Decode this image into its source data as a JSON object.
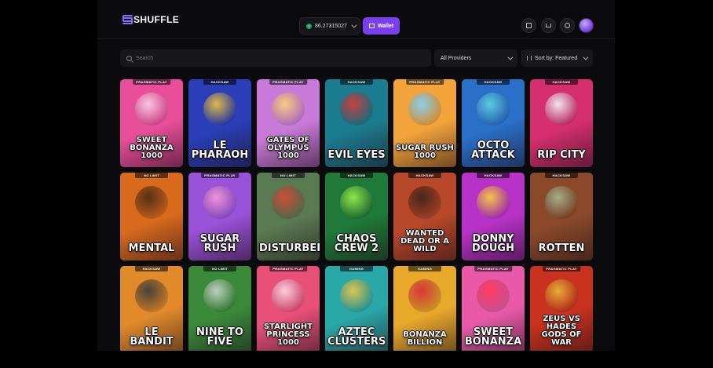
{
  "header": {
    "logo_text": "SHUFFLE",
    "balance": "86.27315027",
    "wallet_label": "Wallet",
    "icons": [
      "rewards-icon",
      "vip-crown-icon",
      "chat-icon"
    ]
  },
  "filters": {
    "search_placeholder": "Search",
    "provider_select": "All Providers",
    "sort_select": "Sort by: Featured"
  },
  "games": [
    {
      "title": "Sweet Bonanza 1000",
      "provider": "PRAGMATIC PLAY",
      "bg": "#e94e9a",
      "accent": "#ffd1ec"
    },
    {
      "title": "Le Pharaoh",
      "provider": "HACKSAW",
      "bg": "#2a3fb8",
      "accent": "#f0c542"
    },
    {
      "title": "Gates of Olympus 1000",
      "provider": "PRAGMATIC PLAY",
      "bg": "#c87ad8",
      "accent": "#ffd27a"
    },
    {
      "title": "Evil Eyes",
      "provider": "HACKSAW",
      "bg": "#1c7c8f",
      "accent": "#d93a3a"
    },
    {
      "title": "Sugar Rush 1000",
      "provider": "PRAGMATIC PLAY",
      "bg": "#f2a33a",
      "accent": "#7fd3ff"
    },
    {
      "title": "Octo Attack",
      "provider": "HACKSAW",
      "bg": "#2a6fc8",
      "accent": "#5fd4e8"
    },
    {
      "title": "Rip City",
      "provider": "HACKSAW",
      "bg": "#d62f6f",
      "accent": "#f7f7f7"
    },
    {
      "title": "Mental",
      "provider": "NO LIMIT",
      "bg": "#d86a1e",
      "accent": "#4a2a12"
    },
    {
      "title": "Sugar Rush",
      "provider": "PRAGMATIC PLAY",
      "bg": "#9a52d8",
      "accent": "#f59ad8"
    },
    {
      "title": "Disturbed",
      "provider": "NO LIMIT",
      "bg": "#5a7a52",
      "accent": "#d84a3a"
    },
    {
      "title": "Chaos Crew 2",
      "provider": "HACKSAW",
      "bg": "#1f7a3a",
      "accent": "#9ef04a"
    },
    {
      "title": "Wanted Dead or a Wild",
      "provider": "HACKSAW",
      "bg": "#b8482a",
      "accent": "#3a2416"
    },
    {
      "title": "Donny Dough",
      "provider": "HACKSAW",
      "bg": "#b832c8",
      "accent": "#ffd23a"
    },
    {
      "title": "Rotten",
      "provider": "HACKSAW",
      "bg": "#8a4a2a",
      "accent": "#a8b896"
    },
    {
      "title": "Le Bandit",
      "provider": "HACKSAW",
      "bg": "#e08a2a",
      "accent": "#3a3a3a"
    },
    {
      "title": "Nine to Five",
      "provider": "NO LIMIT",
      "bg": "#3a8a3a",
      "accent": "#c8d8c8"
    },
    {
      "title": "Starlight Princess 1000",
      "provider": "PRAGMATIC PLAY",
      "bg": "#e8507a",
      "accent": "#ffd8e8"
    },
    {
      "title": "Aztec Clusters",
      "provider": "GAMING",
      "bg": "#2aa8a8",
      "accent": "#f0c848"
    },
    {
      "title": "Bonanza Billion",
      "provider": "GAMING",
      "bg": "#e8a82a",
      "accent": "#d82a3a"
    },
    {
      "title": "Sweet Bonanza",
      "provider": "PRAGMATIC PLAY",
      "bg": "#e85aa8",
      "accent": "#ff3a5a"
    },
    {
      "title": "Zeus vs Hades Gods of War",
      "provider": "PRAGMATIC PLAY",
      "bg": "#c8321e",
      "accent": "#f0b83a"
    }
  ]
}
